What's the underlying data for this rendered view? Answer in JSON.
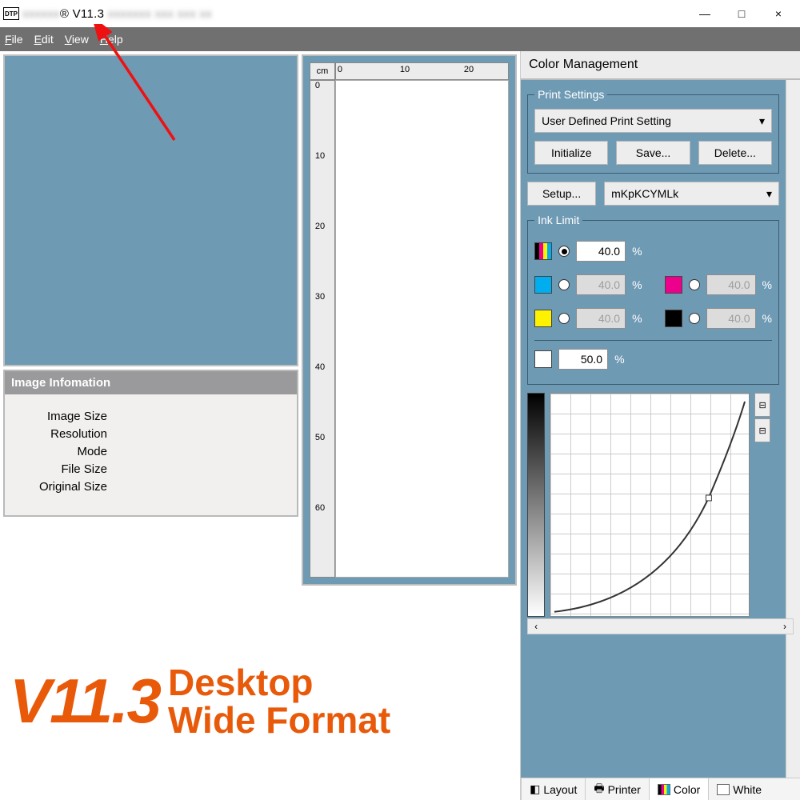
{
  "title": {
    "badge": "DTP",
    "visible": "® V11.3"
  },
  "window": {
    "min": "—",
    "max": "□",
    "close": "×"
  },
  "menu": {
    "file": "File",
    "edit": "Edit",
    "view": "View",
    "help": "Help"
  },
  "imginfo": {
    "heading": "Image Infomation",
    "rows": [
      "Image Size",
      "Resolution",
      "Mode",
      "File Size",
      "Original Size"
    ]
  },
  "ruler": {
    "unit": "cm",
    "h": [
      "0",
      "10",
      "20"
    ],
    "v": [
      "0",
      "10",
      "20",
      "30",
      "40",
      "50",
      "60"
    ]
  },
  "panel": {
    "title": "Color Management",
    "print_settings": {
      "legend": "Print Settings",
      "preset": "User Defined Print Setting",
      "initialize": "Initialize",
      "save": "Save...",
      "delete": "Delete..."
    },
    "setup": "Setup...",
    "profile": "mKpKCYMLk",
    "ink": {
      "legend": "Ink Limit",
      "total": "40.0",
      "c": "40.0",
      "m": "40.0",
      "y": "40.0",
      "k": "40.0",
      "white": "50.0",
      "pct": "%"
    }
  },
  "tabs": {
    "layout": "Layout",
    "printer": "Printer",
    "color": "Color",
    "white": "White"
  },
  "overlay": {
    "ver": "V11.3",
    "l1": "Desktop",
    "l2": "Wide Format"
  }
}
